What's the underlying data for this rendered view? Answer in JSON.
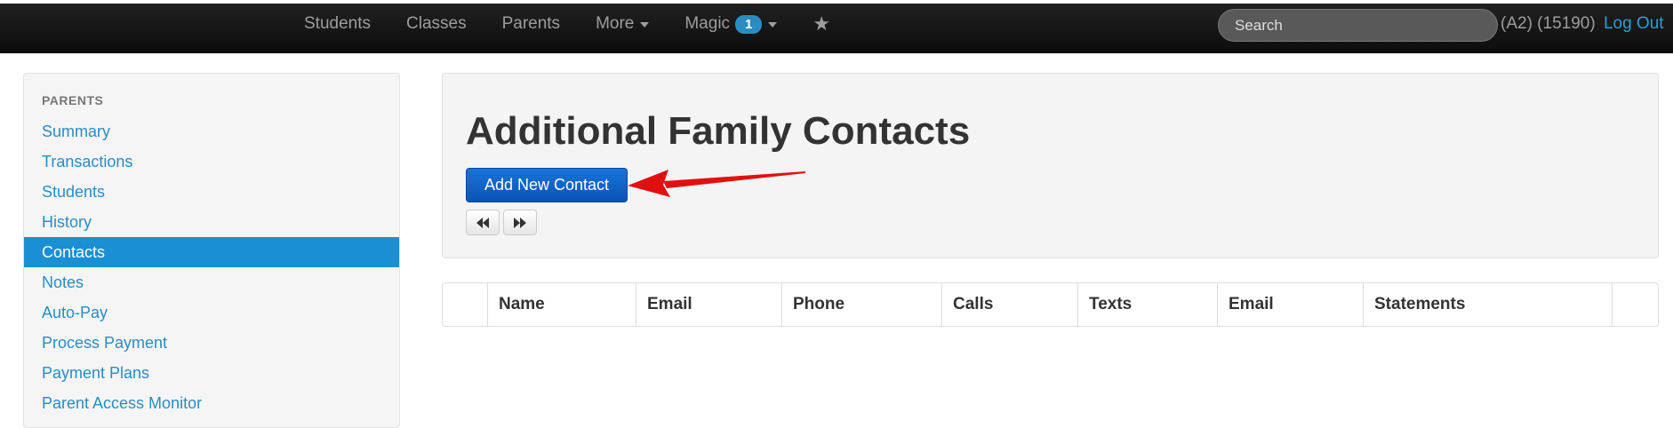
{
  "navbar": {
    "items": [
      {
        "label": "Students"
      },
      {
        "label": "Classes"
      },
      {
        "label": "Parents"
      },
      {
        "label": "More"
      },
      {
        "label": "Magic",
        "badge": "1"
      }
    ],
    "search_placeholder": "Search",
    "user_info": "(A2) (15190)",
    "logout_label": "Log Out"
  },
  "sidebar": {
    "header": "PARENTS",
    "items": [
      {
        "label": "Summary"
      },
      {
        "label": "Transactions"
      },
      {
        "label": "Students"
      },
      {
        "label": "History"
      },
      {
        "label": "Contacts",
        "active": true
      },
      {
        "label": "Notes"
      },
      {
        "label": "Auto-Pay"
      },
      {
        "label": "Process Payment"
      },
      {
        "label": "Payment Plans"
      },
      {
        "label": "Parent Access Monitor"
      }
    ]
  },
  "main": {
    "title": "Additional Family Contacts",
    "add_button_label": "Add New Contact"
  },
  "table": {
    "columns": [
      "",
      "Name",
      "Email",
      "Phone",
      "Calls",
      "Texts",
      "Email",
      "Statements",
      ""
    ]
  },
  "colors": {
    "accent": "#2a8cc3",
    "active_item": "#1a8fd4",
    "primary_button": "#0a53b6",
    "annotation_arrow": "#e01010"
  },
  "icons": [
    "caret-down-icon",
    "star-icon",
    "fast-backward-icon",
    "fast-forward-icon",
    "red-arrow-annotation"
  ]
}
